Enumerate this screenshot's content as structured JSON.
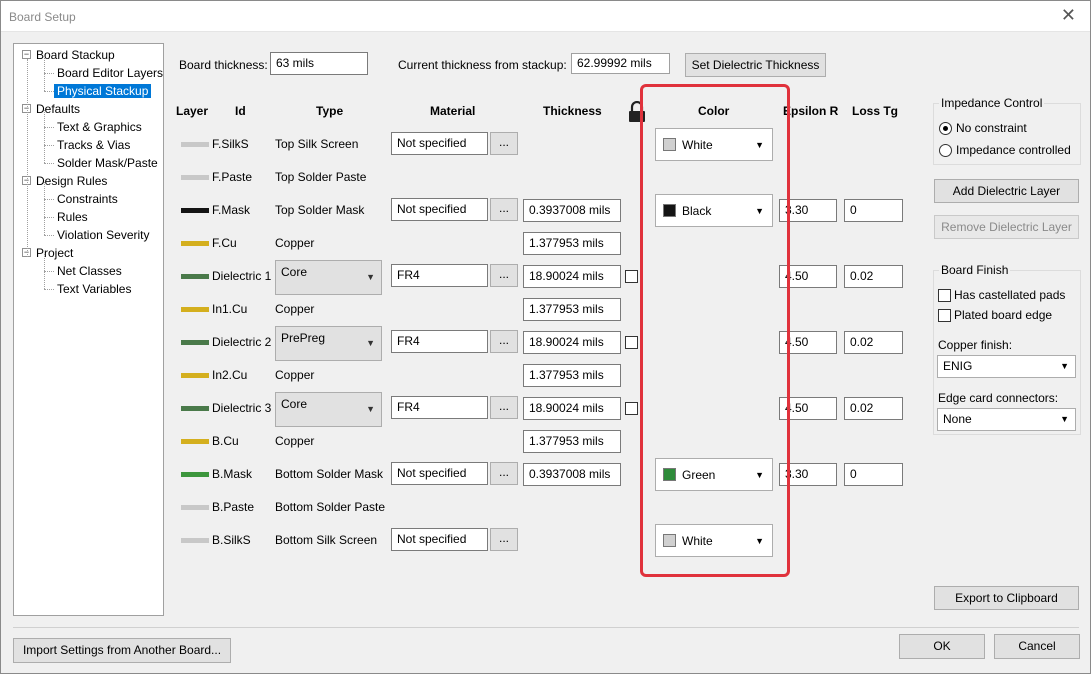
{
  "window": {
    "title": "Board Setup",
    "close_glyph": "✕"
  },
  "tree": {
    "items": [
      {
        "label": "Board Stackup",
        "level": 0,
        "expander": "−"
      },
      {
        "label": "Board Editor Layers",
        "level": 1
      },
      {
        "label": "Physical Stackup",
        "level": 1,
        "selected": true
      },
      {
        "label": "Defaults",
        "level": 0,
        "expander": "−"
      },
      {
        "label": "Text & Graphics",
        "level": 1
      },
      {
        "label": "Tracks & Vias",
        "level": 1
      },
      {
        "label": "Solder Mask/Paste",
        "level": 1
      },
      {
        "label": "Design Rules",
        "level": 0,
        "expander": "−"
      },
      {
        "label": "Constraints",
        "level": 1
      },
      {
        "label": "Rules",
        "level": 1
      },
      {
        "label": "Violation Severity",
        "level": 1
      },
      {
        "label": "Project",
        "level": 0,
        "expander": "−"
      },
      {
        "label": "Net Classes",
        "level": 1
      },
      {
        "label": "Text Variables",
        "level": 1
      }
    ]
  },
  "top": {
    "board_thickness_label": "Board thickness:",
    "board_thickness_value": "63 mils",
    "current_thickness_label": "Current thickness from stackup:",
    "current_thickness_value": "62.99992 mils",
    "set_dielectric_button": "Set Dielectric Thickness"
  },
  "headers": {
    "layer": "Layer",
    "id": "Id",
    "type": "Type",
    "material": "Material",
    "thickness": "Thickness",
    "lock_icon": "lock-icon",
    "color": "Color",
    "epsilon": "Epsilon R",
    "loss": "Loss Tg"
  },
  "rows": [
    {
      "id": "F.SilkS",
      "swatch": "#c8c8c8",
      "type": "Top Silk Screen",
      "material": "Not specified",
      "color": "White",
      "color_hex": "#d0d0d0"
    },
    {
      "id": "F.Paste",
      "swatch": "#c8c8c8",
      "type": "Top Solder Paste"
    },
    {
      "id": "F.Mask",
      "swatch": "#141414",
      "type": "Top Solder Mask",
      "material": "Not specified",
      "thickness": "0.3937008 mils",
      "color": "Black",
      "color_hex": "#141414",
      "epsilon": "3.30",
      "loss": "0"
    },
    {
      "id": "F.Cu",
      "swatch": "#d4af1e",
      "type": "Copper",
      "thickness": "1.377953 mils"
    },
    {
      "id": "Dielectric 1",
      "swatch": "#4a7a4a",
      "type": "Core",
      "combo": true,
      "material": "FR4",
      "thickness": "18.90024 mils",
      "lock": true,
      "epsilon": "4.50",
      "loss": "0.02"
    },
    {
      "id": "In1.Cu",
      "swatch": "#d4af1e",
      "type": "Copper",
      "thickness": "1.377953 mils"
    },
    {
      "id": "Dielectric 2",
      "swatch": "#4a7a4a",
      "type": "PrePreg",
      "combo": true,
      "material": "FR4",
      "thickness": "18.90024 mils",
      "lock": true,
      "epsilon": "4.50",
      "loss": "0.02"
    },
    {
      "id": "In2.Cu",
      "swatch": "#d4af1e",
      "type": "Copper",
      "thickness": "1.377953 mils"
    },
    {
      "id": "Dielectric 3",
      "swatch": "#4a7a4a",
      "type": "Core",
      "combo": true,
      "material": "FR4",
      "thickness": "18.90024 mils",
      "lock": true,
      "epsilon": "4.50",
      "loss": "0.02"
    },
    {
      "id": "B.Cu",
      "swatch": "#d4af1e",
      "type": "Copper",
      "thickness": "1.377953 mils"
    },
    {
      "id": "B.Mask",
      "swatch": "#3c963c",
      "type": "Bottom Solder Mask",
      "material": "Not specified",
      "thickness": "0.3937008 mils",
      "color": "Green",
      "color_hex": "#2e8b3a",
      "epsilon": "3.30",
      "loss": "0"
    },
    {
      "id": "B.Paste",
      "swatch": "#c8c8c8",
      "type": "Bottom Solder Paste"
    },
    {
      "id": "B.SilkS",
      "swatch": "#c8c8c8",
      "type": "Bottom Silk Screen",
      "material": "Not specified",
      "color": "White",
      "color_hex": "#d0d0d0"
    }
  ],
  "right": {
    "impedance_title": "Impedance Control",
    "no_constraint": "No constraint",
    "impedance_controlled": "Impedance controlled",
    "add_dielectric": "Add Dielectric Layer",
    "remove_dielectric": "Remove Dielectric Layer",
    "finish_title": "Board Finish",
    "castellated": "Has castellated pads",
    "plated_edge": "Plated board edge",
    "copper_finish_label": "Copper finish:",
    "copper_finish_value": "ENIG",
    "edge_card_label": "Edge card connectors:",
    "edge_card_value": "None",
    "export": "Export to Clipboard"
  },
  "bottom": {
    "import": "Import Settings from Another Board...",
    "ok": "OK",
    "cancel": "Cancel"
  },
  "dots_label": "...",
  "accent": "#0078d7",
  "highlight": "#e0323c"
}
